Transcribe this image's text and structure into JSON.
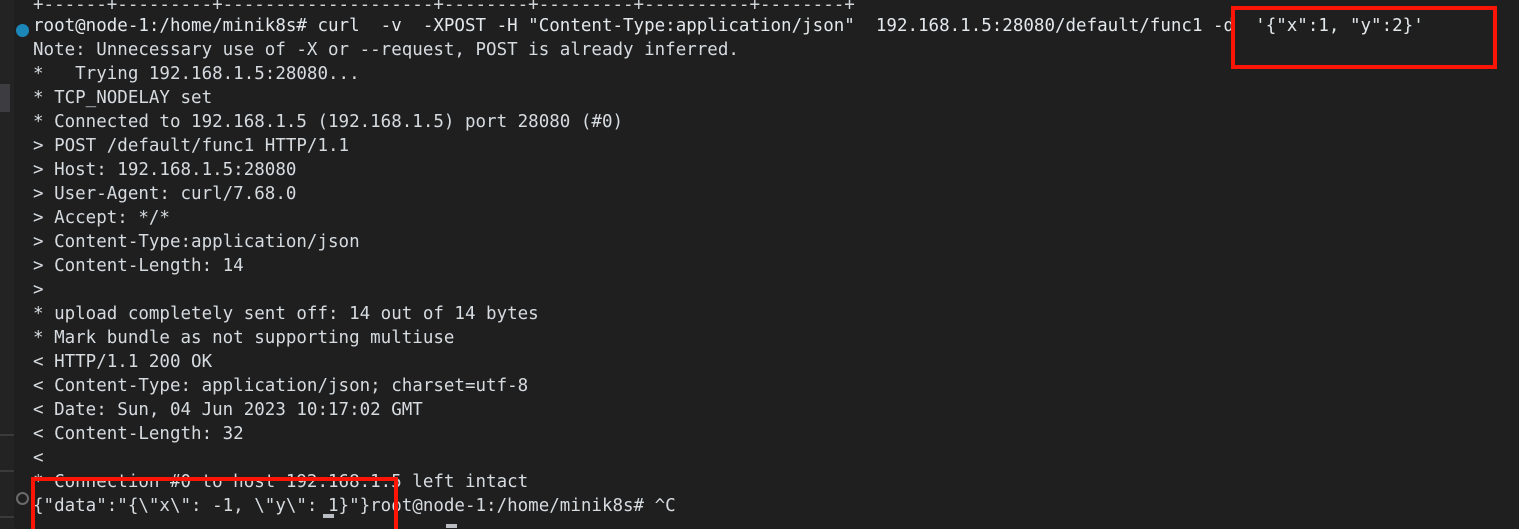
{
  "window": {
    "app": "terminal",
    "background_color": "#1f1f1f",
    "text_color": "#d6dbe0",
    "annotation_color": "#fc1505"
  },
  "gutter": {
    "markers": [
      {
        "name": "active-breakpoint-marker",
        "type": "filled-dot",
        "color": "#1b87b8"
      },
      {
        "name": "inactive-breakpoint-marker",
        "type": "ring",
        "color": "#6a6a6a"
      }
    ]
  },
  "terminal": {
    "prompt": "root@node-1:/home/minik8s#",
    "lines": [
      {
        "id": "table-border",
        "text": "+------+---------+--------------------+--------+---------+----------+--------+"
      },
      {
        "id": "command",
        "text": "root@node-1:/home/minik8s# curl  -v  -XPOST -H \"Content-Type:application/json\"  192.168.1.5:28080/default/func1 -d  '{\"x\":1, \"y\":2}'"
      },
      {
        "id": "note",
        "text": "Note: Unnecessary use of -X or --request, POST is already inferred."
      },
      {
        "id": "trying",
        "text": "*   Trying 192.168.1.5:28080..."
      },
      {
        "id": "tcp-nodelay",
        "text": "* TCP_NODELAY set"
      },
      {
        "id": "connected",
        "text": "* Connected to 192.168.1.5 (192.168.1.5) port 28080 (#0)"
      },
      {
        "id": "req-post",
        "text": "> POST /default/func1 HTTP/1.1"
      },
      {
        "id": "req-host",
        "text": "> Host: 192.168.1.5:28080"
      },
      {
        "id": "req-ua",
        "text": "> User-Agent: curl/7.68.0"
      },
      {
        "id": "req-accept",
        "text": "> Accept: */*"
      },
      {
        "id": "req-ctype",
        "text": "> Content-Type:application/json"
      },
      {
        "id": "req-clen",
        "text": "> Content-Length: 14"
      },
      {
        "id": "req-blank",
        "text": ">"
      },
      {
        "id": "upload",
        "text": "* upload completely sent off: 14 out of 14 bytes"
      },
      {
        "id": "mark-bundle",
        "text": "* Mark bundle as not supporting multiuse"
      },
      {
        "id": "res-status",
        "text": "< HTTP/1.1 200 OK"
      },
      {
        "id": "res-ctype",
        "text": "< Content-Type: application/json; charset=utf-8"
      },
      {
        "id": "res-date",
        "text": "< Date: Sun, 04 Jun 2023 10:17:02 GMT"
      },
      {
        "id": "res-clen",
        "text": "< Content-Length: 32"
      },
      {
        "id": "res-blank",
        "text": "<"
      },
      {
        "id": "connection-left",
        "text": "* Connection #0 to host 192.168.1.5 left intact"
      },
      {
        "id": "response-body",
        "text": "{\"data\":\"{\\\"x\\\": -1, \\\"y\\\": 1}\"}root@node-1:/home/minik8s# ^C"
      }
    ]
  },
  "annotations": [
    {
      "name": "highlight-box-request-payload",
      "covers": "c1 -d  '{\"x\":1, \"y\":2}'",
      "color": "#fc1505"
    },
    {
      "name": "highlight-box-response-payload",
      "covers": "* Connection #0 to host 192.168.1.5 left intact / {\"data\":\"{\\\"x\\\": -1, \\\"y\\\": 1}\"}",
      "color": "#fc1505"
    }
  ]
}
